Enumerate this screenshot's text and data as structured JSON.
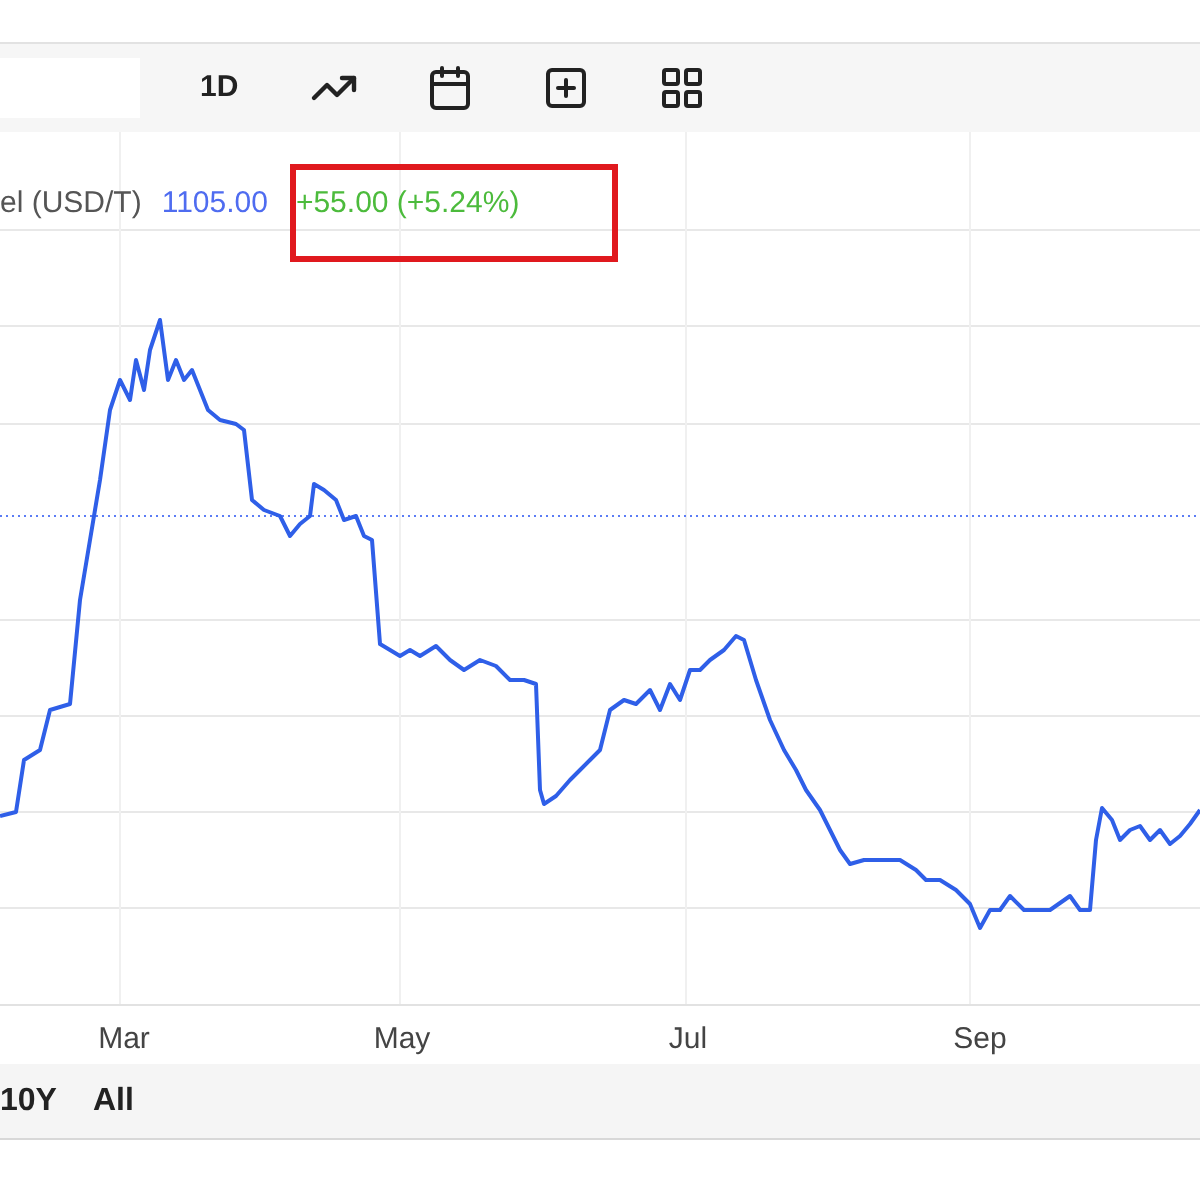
{
  "toolbar": {
    "interval": "1D"
  },
  "legend": {
    "name": "el (USD/T)",
    "price": "1105.00",
    "change": "+55.00 (+5.24%)",
    "highlighted": true
  },
  "x_axis_labels": [
    "Mar",
    "May",
    "Jul",
    "Sep"
  ],
  "ranges": [
    "10Y",
    "All"
  ]
}
